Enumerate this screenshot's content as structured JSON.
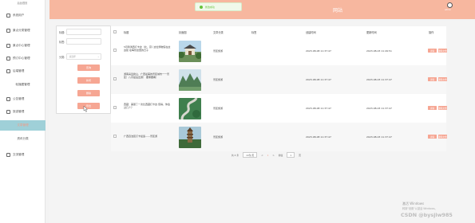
{
  "sidebar": {
    "header": "后台首页",
    "items": [
      {
        "label": "系统用户",
        "icon": "user-icon",
        "center": false,
        "active": false
      },
      {
        "label": "景点分类管理",
        "icon": "folder-icon",
        "center": false,
        "active": false
      },
      {
        "label": "景点中心管理",
        "icon": "pin-icon",
        "center": false,
        "active": false
      },
      {
        "label": "预订中心管理",
        "icon": "calendar-icon",
        "center": false,
        "active": false
      },
      {
        "label": "后端管理",
        "icon": "grid-icon",
        "center": false,
        "active": false
      },
      {
        "label": "轮播图管理",
        "icon": "image-icon",
        "center": true,
        "active": false
      },
      {
        "label": "公告管理",
        "icon": "bell-icon",
        "center": false,
        "active": false
      },
      {
        "label": "旅游管理",
        "icon": "map-icon",
        "center": false,
        "active": false
      },
      {
        "label": "文章管理",
        "icon": "doc-icon",
        "center": true,
        "active": true
      },
      {
        "label": "资讯分类",
        "icon": "list-icon",
        "center": true,
        "active": false
      },
      {
        "label": "交流管理",
        "icon": "chat-icon",
        "center": false,
        "active": false
      }
    ]
  },
  "topbar": {
    "title": "网站",
    "username": "admin"
  },
  "toast": {
    "text": "修改成功"
  },
  "search": {
    "title_label": "标题:",
    "name_label": "标签:",
    "type_label": "分类:",
    "type_placeholder": "请选择",
    "buttons": [
      "查询",
      "新增",
      "删除",
      "导出"
    ]
  },
  "table": {
    "headers": [
      "标题",
      "封面图",
      "文章分类",
      "标签",
      "创建时间",
      "更新时间",
      "操作"
    ],
    "rows": [
      {
        "title": "5月到漓西打卡这（北、京）·这位博物馆在这边建 在每份这里的日子",
        "category": "景区旅游",
        "tag": "",
        "created": "2023-08-08 11:37:47",
        "updated": "2023-08-03 11:49:51",
        "thumb": "temple"
      },
      {
        "title": "游客喜爱爬山、广西最美的景区城市一一景区！八月最后出游！ 要重要看！",
        "category": "景区旅游",
        "tag": "",
        "created": "2023-08-08 11:37:47",
        "updated": "2023-08-03 11:37:47",
        "thumb": "mountain"
      },
      {
        "title": "西藏：美丽了一次比西藏打卡这·值得，你会过几个？",
        "category": "景区旅游",
        "tag": "",
        "created": "2023-08-08 11:37:47",
        "updated": "2023-08-03 11:37:47",
        "thumb": "road"
      },
      {
        "title": "广西自治区打卡最适——景区游",
        "category": "景区旅游",
        "tag": "",
        "created": "2023-08-08 11:37:47",
        "updated": "2023-08-03 11:37:47",
        "thumb": "tower"
      }
    ],
    "action_edit": "详情",
    "action_delete": "删除文章"
  },
  "pager": {
    "total": "共 4 条",
    "size": "10条/页",
    "prev": "<",
    "page": "1",
    "next": ">",
    "goto": "前往",
    "goto_page": "1",
    "suffix": "页"
  },
  "watermark": {
    "line1": "激活 Windows",
    "line2": "转到\"设置\"以激活 Windows。",
    "csdn": "CSDN @bysjlw985"
  },
  "colors": {
    "accent": "#f6a693",
    "topbar": "#f7b79f",
    "active_bg": "#9fd0d8"
  }
}
